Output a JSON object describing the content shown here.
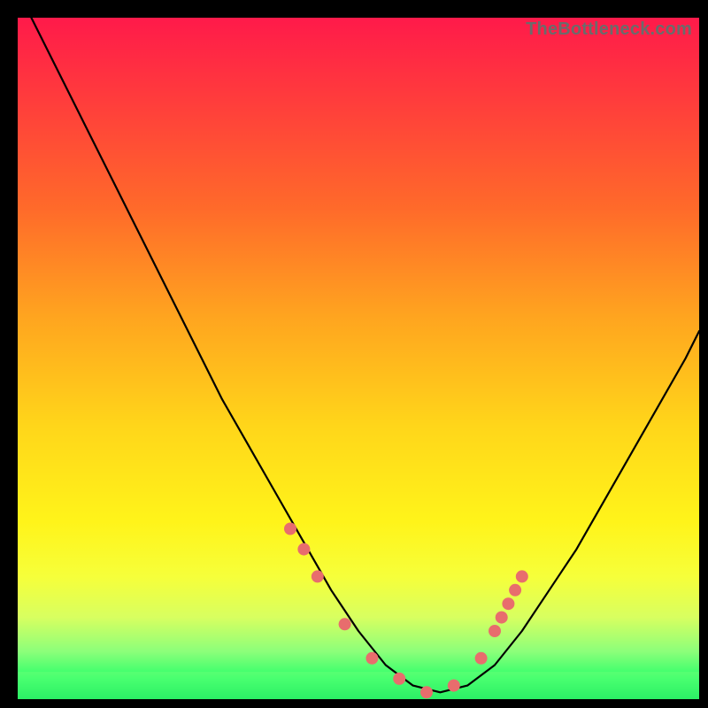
{
  "watermark": "TheBottleneck.com",
  "colors": {
    "curve": "#000000",
    "dots": "#e86d6d",
    "band": "#7fff7a"
  },
  "chart_data": {
    "type": "line",
    "title": "",
    "xlabel": "",
    "ylabel": "",
    "xlim": [
      0,
      100
    ],
    "ylim": [
      0,
      100
    ],
    "series": [
      {
        "name": "bottleneck-curve",
        "x": [
          2,
          6,
          10,
          14,
          18,
          22,
          26,
          30,
          34,
          38,
          42,
          46,
          50,
          54,
          58,
          62,
          66,
          70,
          74,
          78,
          82,
          86,
          90,
          94,
          98,
          100
        ],
        "y": [
          100,
          92,
          84,
          76,
          68,
          60,
          52,
          44,
          37,
          30,
          23,
          16,
          10,
          5,
          2,
          1,
          2,
          5,
          10,
          16,
          22,
          29,
          36,
          43,
          50,
          54
        ]
      }
    ],
    "markers": {
      "name": "highlight-dots",
      "x": [
        40,
        42,
        44,
        48,
        52,
        56,
        60,
        64,
        68,
        70,
        71,
        72,
        73,
        74
      ],
      "y": [
        25,
        22,
        18,
        11,
        6,
        3,
        1,
        2,
        6,
        10,
        12,
        14,
        16,
        18
      ]
    },
    "band": {
      "y0": 0,
      "y1": 4
    }
  }
}
